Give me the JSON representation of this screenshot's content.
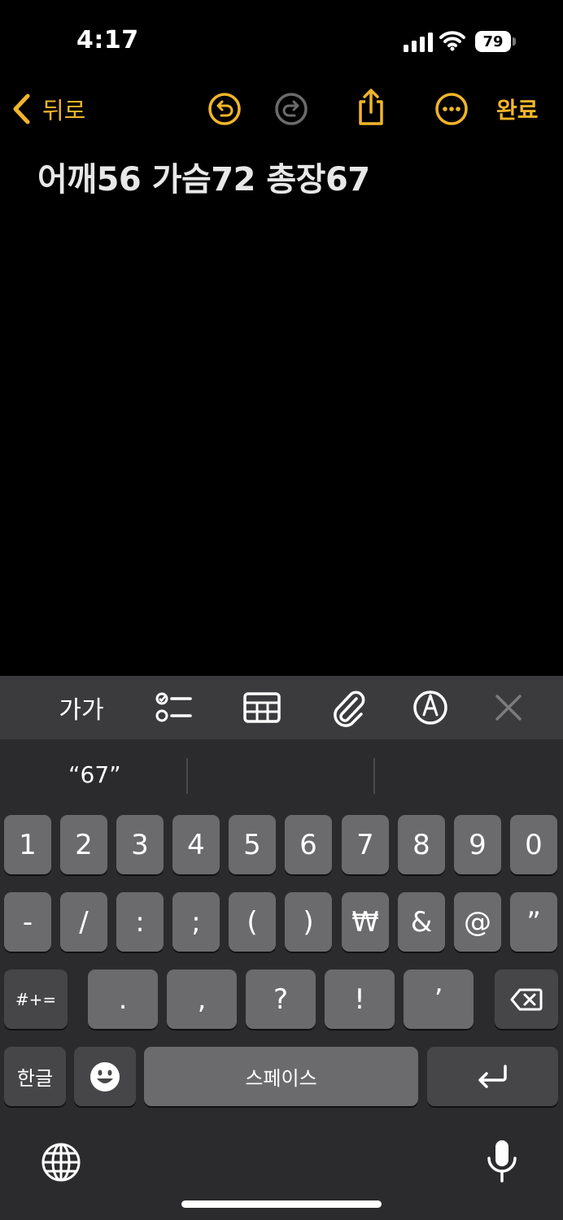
{
  "status_bar": {
    "time": "4:17",
    "battery_level": "79"
  },
  "nav": {
    "back_label": "뒤로",
    "done_label": "완료"
  },
  "note": {
    "text": "어깨56 가슴72 총장67"
  },
  "format_bar": {
    "text_style_label": "가가"
  },
  "suggestions": {
    "items": [
      "“67”",
      "",
      ""
    ]
  },
  "keyboard": {
    "row1": [
      "1",
      "2",
      "3",
      "4",
      "5",
      "6",
      "7",
      "8",
      "9",
      "0"
    ],
    "row2": [
      "-",
      "/",
      ":",
      ";",
      "(",
      ")",
      "₩",
      "&",
      "@",
      "”"
    ],
    "row3": [
      ".",
      ",",
      "?",
      "!",
      "’"
    ],
    "symbols_key": "#+=",
    "lang_key": "한글",
    "space_key": "스페이스"
  },
  "colors": {
    "accent": "#f2b52a",
    "key": "#6b6b6d",
    "key_dark": "#464648",
    "keyboard_bg": "#2b2b2d"
  }
}
